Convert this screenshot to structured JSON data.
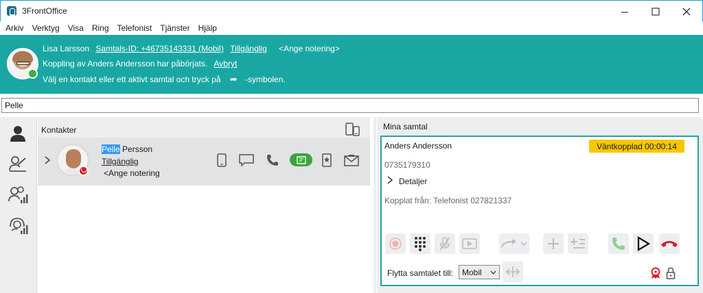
{
  "window": {
    "title": "3FrontOffice"
  },
  "menu": [
    "Arkiv",
    "Verktyg",
    "Visa",
    "Ring",
    "Telefonist",
    "Tjänster",
    "Hjälp"
  ],
  "banner": {
    "user_name": "Lisa Larsson",
    "call_id": "Samtals-ID: +46735143331 (Mobil)",
    "status": "Tillgänglig",
    "note": "<Ange notering>",
    "transfer_text": "Koppling av Anders Andersson har påbörjats.",
    "cancel_link": "Avbryt",
    "instruction_before": "Välj en kontakt eller ett aktivt samtal och tryck på",
    "instruction_after": "-symbolen.",
    "transfer_symbol": "➦"
  },
  "search": {
    "value": "Pelle"
  },
  "contacts": {
    "header": "Kontakter",
    "items": [
      {
        "name_highlight": "Pelle",
        "name_rest": " Persson",
        "status": "Tillgänglig",
        "note": "<Ange notering>",
        "presence_color": "#d51f2d"
      }
    ]
  },
  "calls": {
    "header": "Mina samtal",
    "active": {
      "caller": "Anders Andersson",
      "hold_badge": "Väntkopplad 00:00:14",
      "number": "0735179310",
      "details_label": "Detaljer",
      "from_line": "Kopplat från: Telefonist 027821337",
      "move_label": "Flytta samtalet till:",
      "move_selected": "Mobil"
    }
  },
  "colors": {
    "banner": "#1aa7a4",
    "hold": "#f7c800",
    "available": "#3cae3c",
    "busy": "#d51f2d",
    "card_border": "#22a6a2"
  }
}
